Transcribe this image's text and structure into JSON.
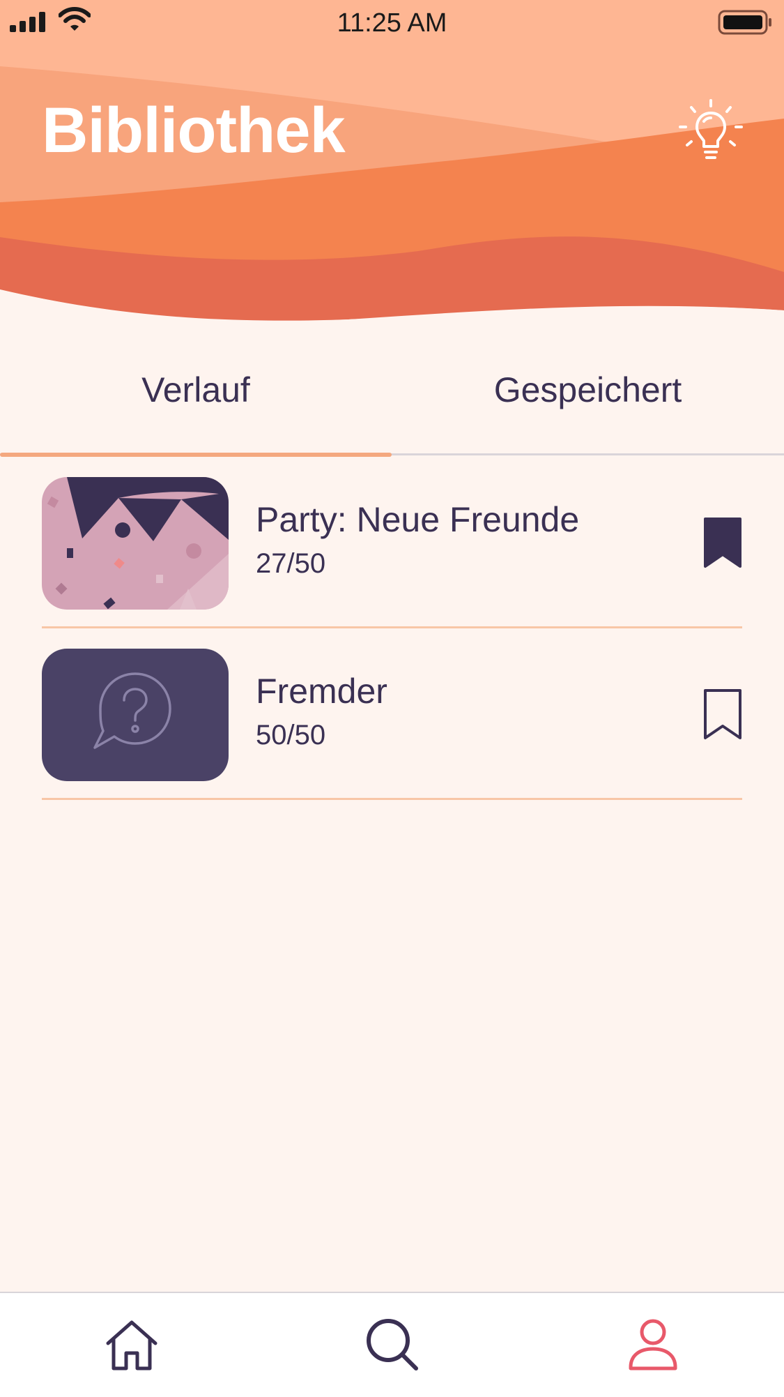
{
  "status_bar": {
    "time": "11:25 AM"
  },
  "header": {
    "title": "Bibliothek",
    "tip_icon": "lightbulb-icon"
  },
  "tabs": [
    {
      "label": "Verlauf",
      "active": true
    },
    {
      "label": "Gespeichert",
      "active": false
    }
  ],
  "items": [
    {
      "title": "Party: Neue Freunde",
      "progress": "27/50",
      "saved": true,
      "thumbnail": "party-confetti"
    },
    {
      "title": "Fremder",
      "progress": "50/50",
      "saved": false,
      "thumbnail": "question-bubble-icon"
    }
  ],
  "bottom_nav": [
    {
      "name": "home-icon",
      "active": false
    },
    {
      "name": "search-icon",
      "active": false
    },
    {
      "name": "profile-icon",
      "active": true
    }
  ],
  "colors": {
    "background": "#fef4ef",
    "accent": "#f4a87f",
    "text": "#3a3053",
    "active_nav": "#e8596a",
    "thumb_dark": "#4a4266",
    "thumb_pink": "#d4a3b6"
  }
}
